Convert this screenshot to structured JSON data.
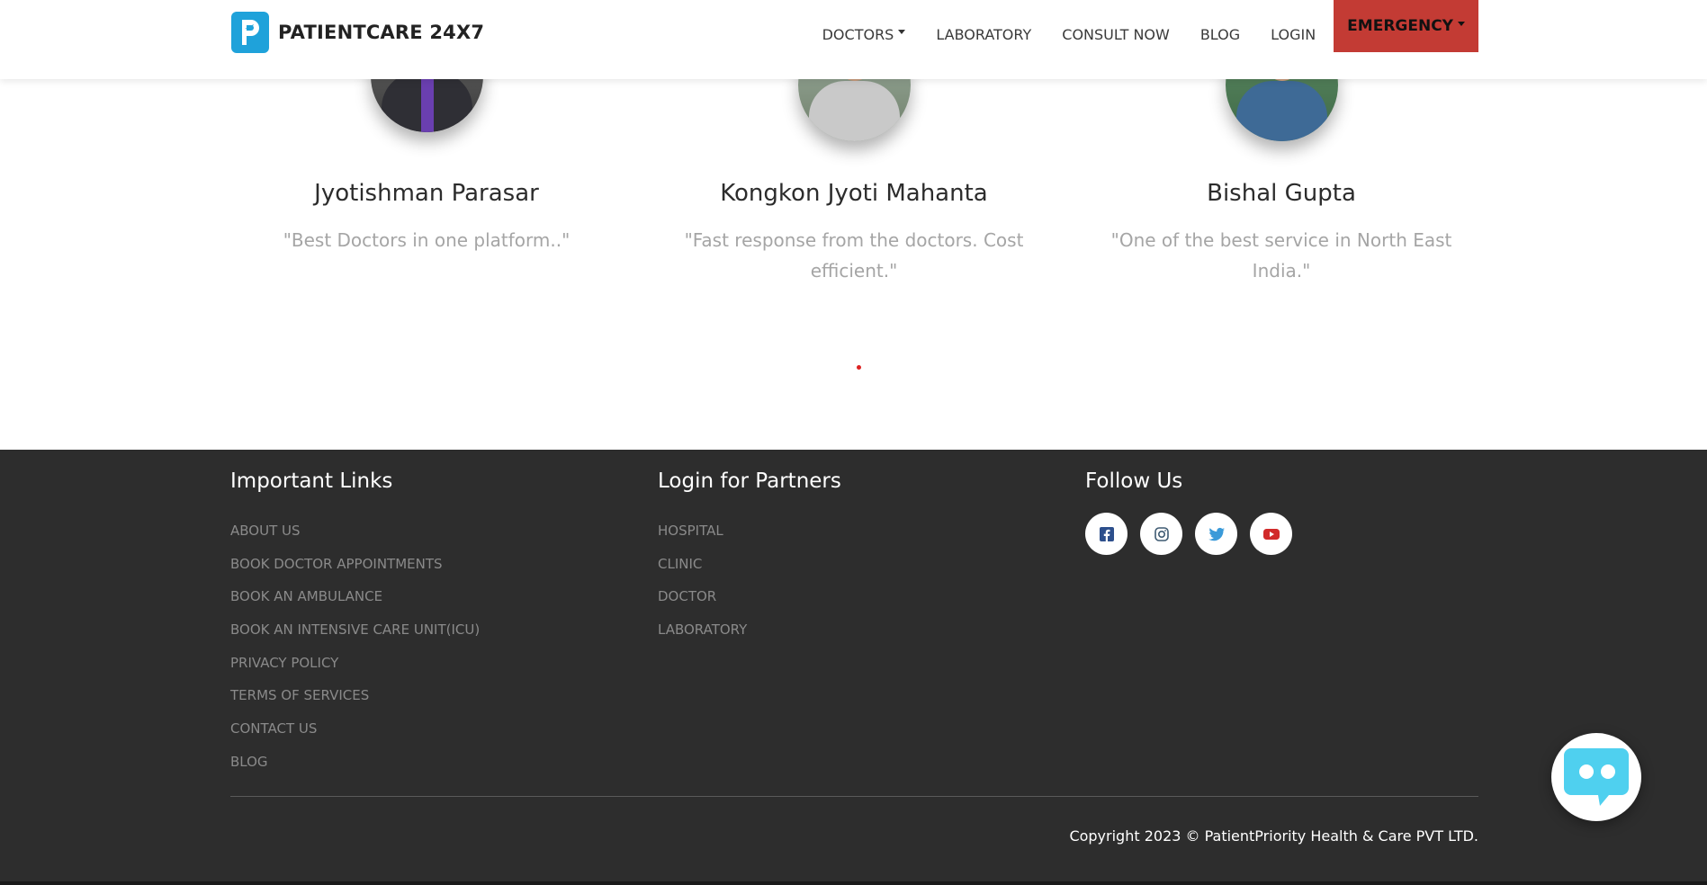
{
  "header": {
    "brand_name": "PATIENTCARE 24X7",
    "nav": {
      "doctors": "DOCTORS",
      "laboratory": "LABORATORY",
      "consult_now": "CONSULT NOW",
      "blog": "BLOG",
      "login": "LOGIN",
      "emergency": "EMERGENCY"
    },
    "emergency_color": "#c33b34",
    "brand_color": "#1fa2da"
  },
  "testimonials": [
    {
      "name": "Jyotishman Parasar",
      "quote": "\"Best Doctors in one platform..\""
    },
    {
      "name": "Kongkon Jyoti Mahanta",
      "quote": "\"Fast response from the doctors. Cost efficient.\""
    },
    {
      "name": "Bishal Gupta",
      "quote": "\"One of the best service in North East India.\""
    }
  ],
  "footer": {
    "important_links": {
      "heading": "Important Links",
      "items": [
        "ABOUT US",
        "BOOK DOCTOR APPOINTMENTS",
        "BOOK AN AMBULANCE",
        "BOOK AN INTENSIVE CARE UNIT(ICU)",
        "PRIVACY POLICY",
        "TERMS OF SERVICES",
        "CONTACT US",
        "BLOG"
      ]
    },
    "partners": {
      "heading": "Login for Partners",
      "items": [
        "HOSPITAL",
        "CLINIC",
        "DOCTOR",
        "LABORATORY"
      ]
    },
    "follow": {
      "heading": "Follow Us",
      "icons": [
        "facebook-icon",
        "instagram-icon",
        "twitter-icon",
        "youtube-icon"
      ]
    },
    "copyright": "Copyright 2023 © PatientPriority Health & Care PVT LTD.",
    "background": "#2d2d2d"
  },
  "chat_widget": {
    "icon": "chatbot-icon",
    "color": "#4fd0ef"
  }
}
